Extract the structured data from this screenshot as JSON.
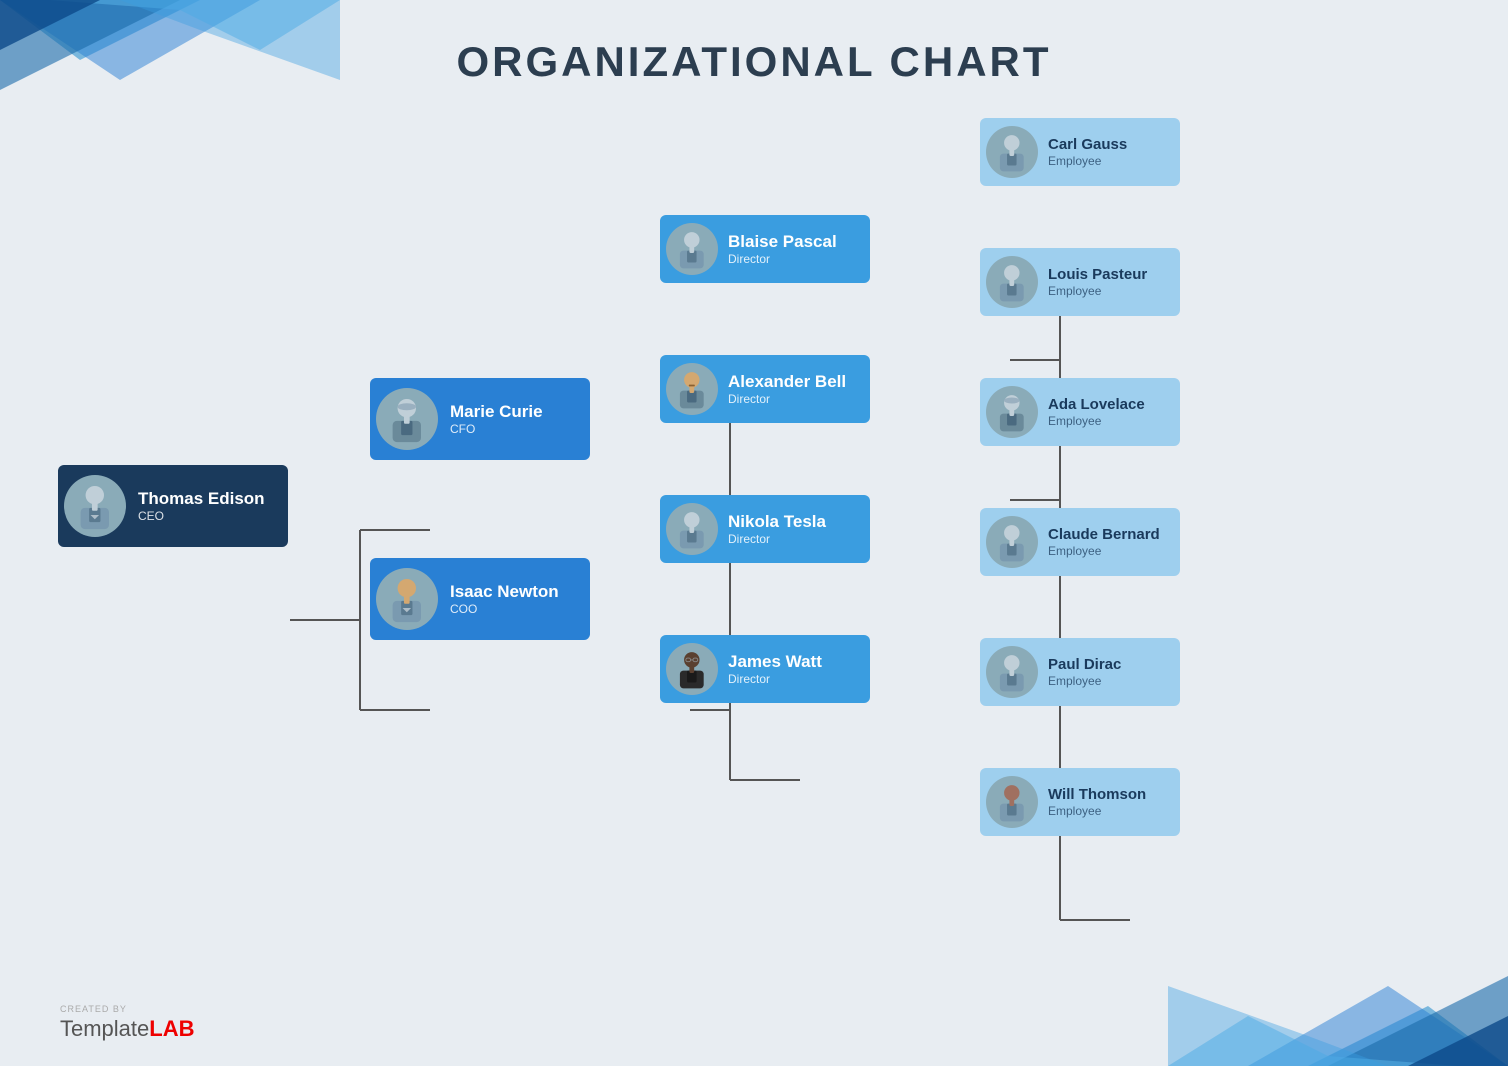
{
  "page": {
    "title": "ORGANIZATIONAL CHART",
    "background_color": "#e8edf2"
  },
  "watermark": {
    "created_by": "CREATED BY",
    "brand_normal": "Template",
    "brand_bold": "LAB"
  },
  "chart": {
    "ceo": {
      "name": "Thomas Edison",
      "title": "CEO",
      "avatar_type": "male_suit"
    },
    "level2": [
      {
        "name": "Marie Curie",
        "title": "CFO",
        "avatar_type": "female_suit"
      },
      {
        "name": "Isaac Newton",
        "title": "COO",
        "avatar_type": "male_casual"
      }
    ],
    "level3": [
      {
        "name": "Blaise Pascal",
        "title": "Director",
        "avatar_type": "male_suit"
      },
      {
        "name": "Alexander Bell",
        "title": "Director",
        "avatar_type": "male_suit2"
      },
      {
        "name": "Nikola Tesla",
        "title": "Director",
        "avatar_type": "male_suit"
      },
      {
        "name": "James Watt",
        "title": "Director",
        "avatar_type": "male_glasses"
      }
    ],
    "level4": [
      {
        "name": "Carl Gauss",
        "title": "Employee",
        "avatar_type": "male_suit"
      },
      {
        "name": "Louis Pasteur",
        "title": "Employee",
        "avatar_type": "male_suit"
      },
      {
        "name": "Ada Lovelace",
        "title": "Employee",
        "avatar_type": "female_suit2"
      },
      {
        "name": "Claude Bernard",
        "title": "Employee",
        "avatar_type": "male_suit"
      },
      {
        "name": "Paul Dirac",
        "title": "Employee",
        "avatar_type": "male_suit"
      },
      {
        "name": "Will Thomson",
        "title": "Employee",
        "avatar_type": "male_casual2"
      }
    ]
  }
}
